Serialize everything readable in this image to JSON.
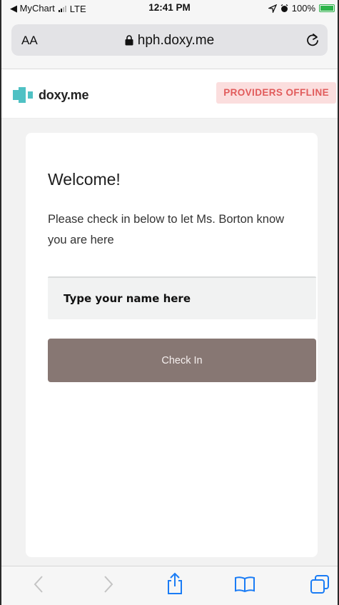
{
  "status_bar": {
    "back_app": "◀ MyChart",
    "network": "LTE",
    "time": "12:41 PM",
    "battery": "100%"
  },
  "browser": {
    "text_size_label": "AA",
    "url": "hph.doxy.me"
  },
  "site": {
    "logo_text": "doxy.me",
    "status_badge": "PROVIDERS OFFLINE",
    "accent_color": "#4fc1c4",
    "badge_color": "#e15b5b"
  },
  "checkin": {
    "heading": "Welcome!",
    "message": "Please check in below to let Ms. Borton know you are here",
    "name_placeholder": "Type your name here",
    "button_label": "Check In",
    "button_color": "#877773"
  },
  "toolbar": {
    "icons": [
      "back-icon",
      "forward-icon",
      "share-icon",
      "bookmarks-icon",
      "tabs-icon"
    ]
  }
}
